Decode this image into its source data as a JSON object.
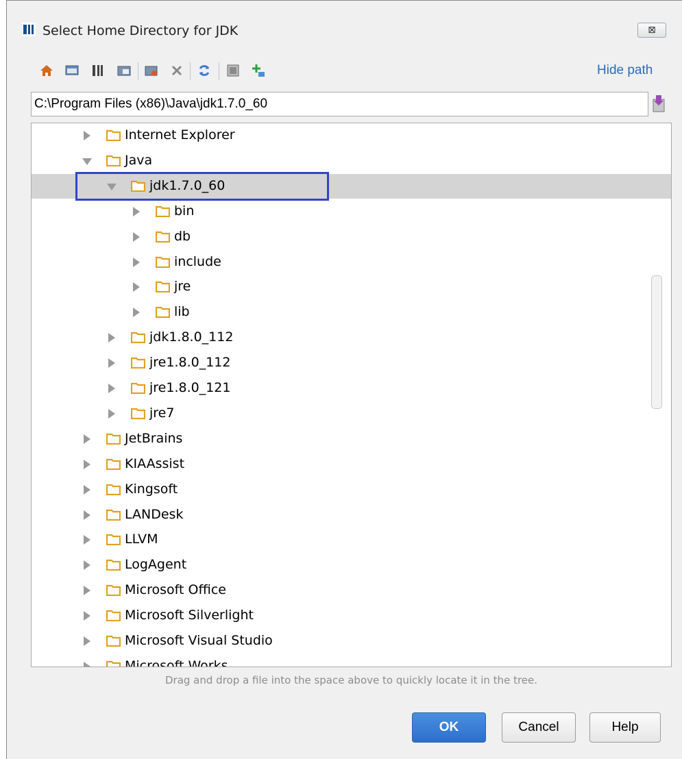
{
  "window": {
    "title": "Select Home Directory for JDK",
    "close_glyph": "⊠"
  },
  "toolbar": {
    "icons": [
      "home-icon",
      "desktop-icon",
      "project-icon",
      "module-icon",
      "new-folder-icon",
      "delete-icon",
      "refresh-icon",
      "show-hidden-icon",
      "add-icon"
    ],
    "hide_path_label": "Hide path"
  },
  "path": {
    "value": "C:\\Program Files (x86)\\Java\\jdk1.7.0_60"
  },
  "tree": {
    "rows": [
      {
        "label": "Internet Explorer",
        "depth": 0,
        "expanded": false,
        "selected": false
      },
      {
        "label": "Java",
        "depth": 0,
        "expanded": true,
        "selected": false
      },
      {
        "label": "jdk1.7.0_60",
        "depth": 1,
        "expanded": true,
        "selected": true
      },
      {
        "label": "bin",
        "depth": 2,
        "expanded": false,
        "selected": false
      },
      {
        "label": "db",
        "depth": 2,
        "expanded": false,
        "selected": false
      },
      {
        "label": "include",
        "depth": 2,
        "expanded": false,
        "selected": false
      },
      {
        "label": "jre",
        "depth": 2,
        "expanded": false,
        "selected": false
      },
      {
        "label": "lib",
        "depth": 2,
        "expanded": false,
        "selected": false
      },
      {
        "label": "jdk1.8.0_112",
        "depth": 1,
        "expanded": false,
        "selected": false
      },
      {
        "label": "jre1.8.0_112",
        "depth": 1,
        "expanded": false,
        "selected": false
      },
      {
        "label": "jre1.8.0_121",
        "depth": 1,
        "expanded": false,
        "selected": false
      },
      {
        "label": "jre7",
        "depth": 1,
        "expanded": false,
        "selected": false
      },
      {
        "label": "JetBrains",
        "depth": 0,
        "expanded": false,
        "selected": false
      },
      {
        "label": "KIAAssist",
        "depth": 0,
        "expanded": false,
        "selected": false
      },
      {
        "label": "Kingsoft",
        "depth": 0,
        "expanded": false,
        "selected": false
      },
      {
        "label": "LANDesk",
        "depth": 0,
        "expanded": false,
        "selected": false
      },
      {
        "label": "LLVM",
        "depth": 0,
        "expanded": false,
        "selected": false
      },
      {
        "label": "LogAgent",
        "depth": 0,
        "expanded": false,
        "selected": false
      },
      {
        "label": "Microsoft Office",
        "depth": 0,
        "expanded": false,
        "selected": false
      },
      {
        "label": "Microsoft Silverlight",
        "depth": 0,
        "expanded": false,
        "selected": false
      },
      {
        "label": "Microsoft Visual Studio",
        "depth": 0,
        "expanded": false,
        "selected": false
      },
      {
        "label": "Microsoft Works",
        "depth": 0,
        "expanded": false,
        "selected": false
      }
    ]
  },
  "hint": "Drag and drop a file into the space above to quickly locate it in the tree.",
  "buttons": {
    "ok": "OK",
    "cancel": "Cancel",
    "help": "Help"
  },
  "colors": {
    "accent": "#2c6fcc",
    "selection_border": "#3045c8",
    "folder": "#e0a020",
    "link": "#2a6bb5"
  }
}
